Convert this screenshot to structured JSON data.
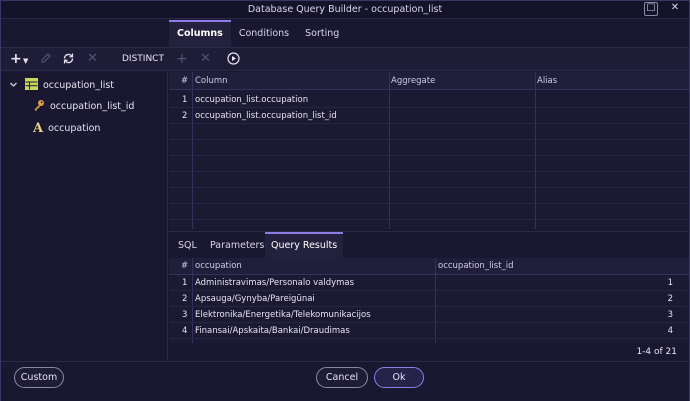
{
  "window": {
    "title": "Database Query Builder - occupation_list",
    "minimize_glyph": "☐",
    "close_glyph": "✕"
  },
  "tabs": [
    {
      "label": "Columns",
      "active": true
    },
    {
      "label": "Conditions",
      "active": false
    },
    {
      "label": "Sorting",
      "active": false
    }
  ],
  "toolbar": {
    "add_icon": "plus-icon",
    "edit_icon": "pencil-icon",
    "refresh_icon": "refresh-icon",
    "delete_icon": "x-icon",
    "distinct_label": "DISTINCT",
    "play_icon": "play-icon"
  },
  "tree": {
    "table": {
      "label": "occupation_list",
      "icon": "table-icon"
    },
    "fields": [
      {
        "label": "occupation_list_id",
        "icon": "key-icon"
      },
      {
        "label": "occupation",
        "icon": "text-field-icon"
      }
    ]
  },
  "columns_grid": {
    "headers": [
      "#",
      "Column",
      "Aggregate",
      "Alias"
    ],
    "rows": [
      {
        "num": "1",
        "column": "occupation_list.occupation",
        "aggregate": "",
        "alias": ""
      },
      {
        "num": "2",
        "column": "occupation_list.occupation_list_id",
        "aggregate": "",
        "alias": ""
      }
    ]
  },
  "bottom_tabs": [
    {
      "label": "SQL",
      "active": false
    },
    {
      "label": "Parameters",
      "active": false
    },
    {
      "label": "Query Results",
      "active": true
    }
  ],
  "results": {
    "headers": [
      "#",
      "occupation",
      "occupation_list_id"
    ],
    "rows": [
      {
        "num": "1",
        "occupation": "Administravimas/Personalo valdymas",
        "id": "1"
      },
      {
        "num": "2",
        "occupation": "Apsauga/Gynyba/Pareigūnai",
        "id": "2"
      },
      {
        "num": "3",
        "occupation": "Elektronika/Energetika/Telekomunikacijos",
        "id": "3"
      },
      {
        "num": "4",
        "occupation": "Finansai/Apskaita/Bankai/Draudimas",
        "id": "4"
      }
    ],
    "pager": "1-4 of 21"
  },
  "footer": {
    "custom_label": "Custom",
    "cancel_label": "Cancel",
    "ok_label": "Ok"
  },
  "colors": {
    "accent": "#8d7ce8",
    "background": "#1a1830",
    "key_icon": "#e0a04a",
    "table_icon": "#c8d65a",
    "text_icon": "#e6d08a"
  }
}
